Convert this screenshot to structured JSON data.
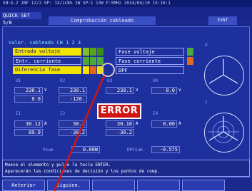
{
  "top": {
    "status_line": "SN:S-2 2NF  12/2   SP: 1X/1CB%  2W  SP:1 13W  F:5MHz   2014/04/10 15:16:1",
    "quick_set": "QUICK SET 5/8",
    "title": "Comprobación cableado",
    "event": "EVNT"
  },
  "panel": {
    "valor_cableado": "Valor. cableado  CH 1 2 3",
    "checks": [
      {
        "label": "Entrada voltaje",
        "style": "yellow",
        "cells": [
          "#7fbf2a",
          "#5aa21a",
          "#f4e300"
        ]
      },
      {
        "label": "Entr. corriente",
        "style": "outline",
        "cells": [
          "#4ca83a",
          "#4ca83a",
          "#4ca83a"
        ]
      },
      {
        "label": "Diferencia fase",
        "style": "yellow",
        "cells": [
          "#f4e300",
          "#e06a1a",
          "#f4e300"
        ]
      }
    ],
    "right_checks": [
      {
        "label": "Fase voltaje",
        "cell": "#4ca83a"
      },
      {
        "label": "Fase corriente",
        "cell": "#e06a1a"
      },
      {
        "label": "DPF",
        "cell": ""
      }
    ],
    "voltage_headers": [
      "U1",
      "U2",
      "U3",
      "U4"
    ],
    "voltages": [
      "230.1",
      "230.1",
      "230.1",
      "0.0"
    ],
    "voltage_unit": "V",
    "voltage_angles": [
      "0.0",
      "-120.",
      "",
      ""
    ],
    "current_headers": [
      "I1",
      "I2",
      "I3",
      "I4"
    ],
    "currents": [
      "30.12",
      "30.1",
      "30.10",
      "0.00"
    ],
    "current_unit": "A",
    "current_angles": [
      "89.9",
      "-30.2",
      "-30.2",
      ""
    ],
    "psum_label": "Psum",
    "psum_value": "0.00W",
    "dpf_label": "DPFsum",
    "dpf_value": "-0.575"
  },
  "message": {
    "line1": "Mueva el elemento y pulse la tecla ENTER.",
    "line2": "Aparecerán las condiciones de decisión y los puntos de comp."
  },
  "buttons": [
    "Anterior",
    "Siguien.",
    "",
    "",
    ""
  ],
  "callout": {
    "error_text": "ERROR",
    "color": "#d01414"
  }
}
